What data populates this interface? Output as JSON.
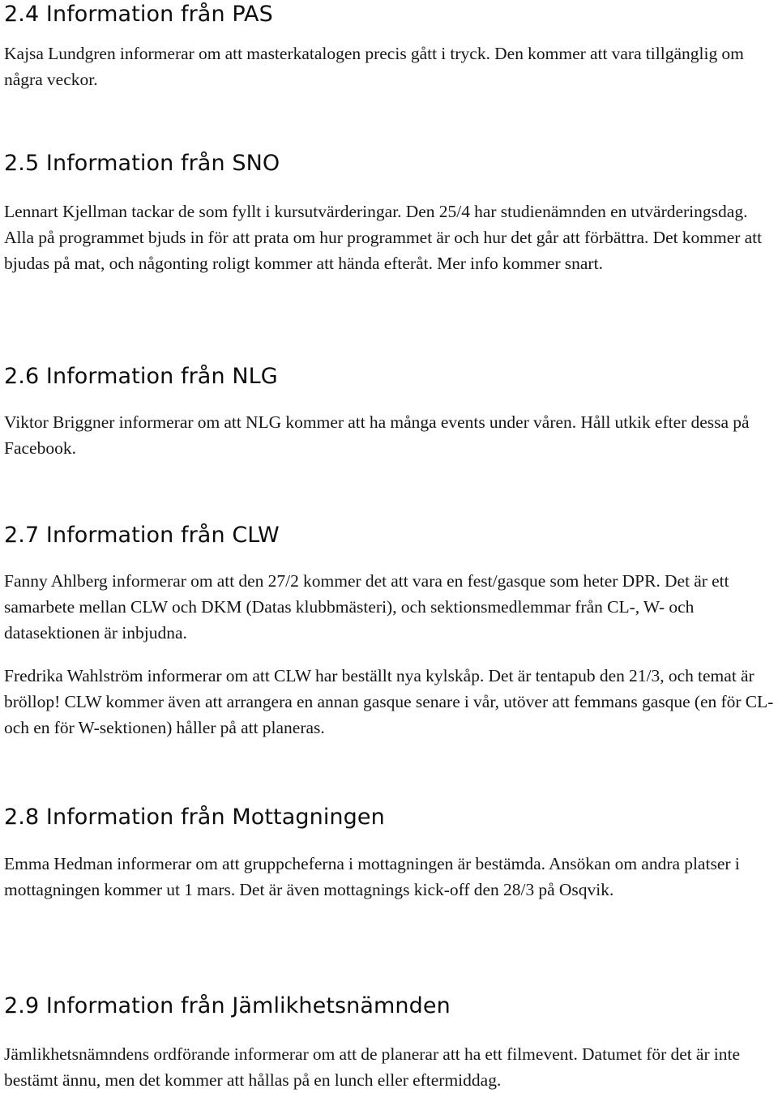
{
  "document": {
    "sections": [
      {
        "id": "2.4",
        "heading": "2.4 Information från PAS",
        "paragraphs": [
          "Kajsa Lundgren informerar om att masterkatalogen precis gått i tryck. Den kommer att vara tillgänglig om några veckor."
        ]
      },
      {
        "id": "2.5",
        "heading": "2.5 Information från SNO",
        "paragraphs": [
          "Lennart Kjellman tackar de som fyllt i kursutvärderingar. Den 25/4 har studienämnden en utvärderingsdag. Alla på programmet bjuds in för att prata om hur programmet är och hur det går att förbättra. Det kommer att bjudas på mat, och någonting roligt kommer att hända efteråt. Mer info kommer snart."
        ]
      },
      {
        "id": "2.6",
        "heading": "2.6 Information från NLG",
        "paragraphs": [
          "Viktor Briggner informerar om att NLG kommer att ha många events under våren. Håll utkik efter dessa på Facebook."
        ]
      },
      {
        "id": "2.7",
        "heading": "2.7 Information från CLW",
        "paragraphs": [
          "Fanny Ahlberg informerar om att den 27/2 kommer det att vara en fest/gasque som heter DPR. Det är ett samarbete mellan CLW och DKM (Datas klubbmästeri), och sektionsmedlemmar från CL-, W- och datasektionen är inbjudna.",
          "Fredrika Wahlström informerar om att CLW har beställt nya kylskåp. Det är tentapub den 21/3, och temat är bröllop! CLW kommer även att arrangera en annan gasque senare i vår, utöver att femmans gasque (en för CL- och en för W-sektionen) håller på att planeras."
        ]
      },
      {
        "id": "2.8",
        "heading": "2.8 Information från Mottagningen",
        "paragraphs": [
          "Emma Hedman informerar om att gruppcheferna i mottagningen är bestämda. Ansökan om andra platser i mottagningen kommer ut 1 mars. Det är även mottagnings kick-off den 28/3 på Osqvik."
        ]
      },
      {
        "id": "2.9",
        "heading": "2.9 Information från Jämlikhetsnämnden",
        "paragraphs": [
          "Jämlikhetsnämndens ordförande informerar om att de planerar att ha ett filmevent. Datumet för det är inte bestämt ännu, men det kommer att hållas på en lunch eller eftermiddag."
        ]
      }
    ]
  }
}
